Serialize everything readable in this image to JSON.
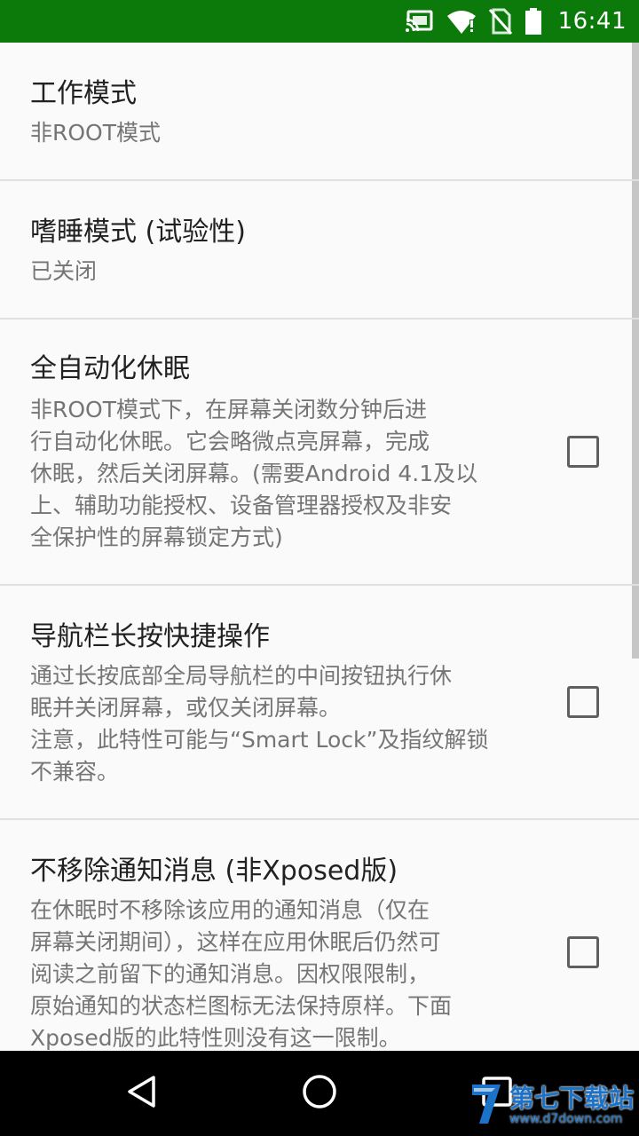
{
  "status_bar": {
    "time": "16:41",
    "icons": [
      "cast-icon",
      "wifi-icon",
      "no-sim-icon",
      "battery-icon"
    ],
    "color": "#0b7a0b"
  },
  "preferences": [
    {
      "title": "工作模式",
      "summary_lines": [
        "非ROOT模式"
      ],
      "has_checkbox": false
    },
    {
      "title": "嗜睡模式 (试验性)",
      "summary_lines": [
        "已关闭"
      ],
      "has_checkbox": false
    },
    {
      "title": "全自动化休眠",
      "summary_lines": [
        "非ROOT模式下，在屏幕关闭数分钟后进",
        "行自动化休眠。它会略微点亮屏幕，完成",
        "休眠，然后关闭屏幕。(需要Android 4.1及以",
        "上、辅助功能授权、设备管理器授权及非安",
        "全保护性的屏幕锁定方式)"
      ],
      "checked": false
    },
    {
      "title": "导航栏长按快捷操作",
      "summary_lines": [
        "通过长按底部全局导航栏的中间按钮执行休",
        "眠并关闭屏幕，或仅关闭屏幕。",
        "注意，此特性可能与“Smart Lock”及指纹解锁",
        "不兼容。"
      ],
      "checked": false
    },
    {
      "title": "不移除通知消息 (非Xposed版)",
      "summary_lines": [
        "在休眠时不移除该应用的通知消息（仅在",
        "屏幕关闭期间），这样在应用休眠后仍然可",
        "阅读之前留下的通知消息。因权限限制，",
        "原始通知的状态栏图标无法保持原样。下面",
        "Xposed版的此特性则没有这一限制。"
      ],
      "checked": false
    }
  ],
  "nav_bar": {
    "buttons": [
      "back-icon",
      "home-icon",
      "recents-icon"
    ]
  },
  "watermark": {
    "title": "第七下载站",
    "url": "www.d7down.com"
  }
}
